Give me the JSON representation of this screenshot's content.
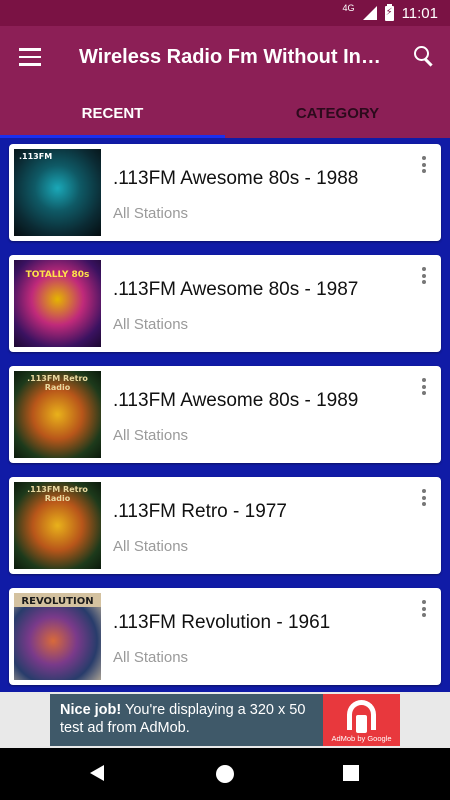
{
  "status_bar": {
    "network": "4G",
    "battery_glyph": "⚡",
    "time": "11:01"
  },
  "app_bar": {
    "title": "Wireless Radio Fm Without Internet",
    "menu_icon": "menu-icon",
    "search_icon": "search-icon"
  },
  "tabs": [
    {
      "label": "RECENT",
      "active": true
    },
    {
      "label": "CATEGORY",
      "active": false
    }
  ],
  "stations": [
    {
      "name": ".113FM Awesome 80s - 1988",
      "subtitle": "All Stations",
      "art_title": ".113FM",
      "art_colors": [
        "#0b2b34",
        "#1aa8b8"
      ]
    },
    {
      "name": ".113FM Awesome 80s - 1987",
      "subtitle": "All Stations",
      "art_title": "TOTALLY 80s",
      "art_colors": [
        "#3a1260",
        "#e5b500"
      ]
    },
    {
      "name": ".113FM Awesome 80s - 1989",
      "subtitle": "All Stations",
      "art_title": ".113FM Retro Radio",
      "art_colors": [
        "#1d3a1b",
        "#e9b21b"
      ]
    },
    {
      "name": ".113FM Retro - 1977",
      "subtitle": "All Stations",
      "art_title": ".113FM Retro Radio",
      "art_colors": [
        "#1d3a1b",
        "#e9b21b"
      ]
    },
    {
      "name": ".113FM Revolution - 1961",
      "subtitle": "All Stations",
      "art_title": "REVOLUTION",
      "art_colors": [
        "#283c6b",
        "#d4c2a0"
      ]
    }
  ],
  "ad": {
    "headline": "Nice job!",
    "body": " You're displaying a 320 x 50 test ad from AdMob.",
    "brand": "AdMob by Google"
  },
  "nav": {
    "back_icon": "back-icon",
    "home_icon": "home-icon",
    "recents_icon": "recents-icon"
  },
  "colors": {
    "status": "#7a1244",
    "app_bar": "#8c1f56",
    "list_bg": "#101ba6",
    "indicator": "#1a2ff0"
  }
}
